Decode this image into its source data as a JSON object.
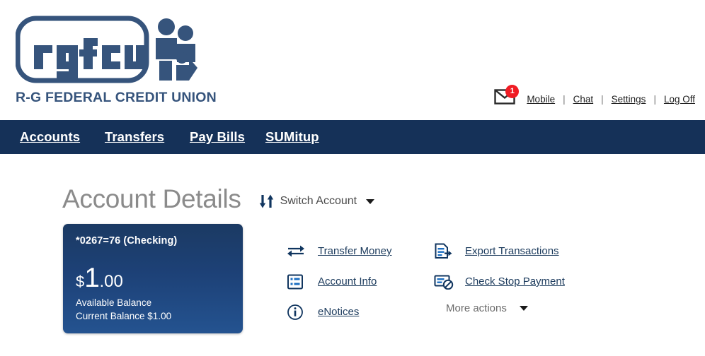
{
  "brand": {
    "logo_text": "rgfcu",
    "tagline": "R-G FEDERAL CREDIT UNION",
    "primary_color": "#153158",
    "logo_color": "#36547c",
    "badge_color": "#f01c24",
    "card_gradient_from": "#1b3a63",
    "card_gradient_to": "#245390"
  },
  "utility_nav": {
    "mail_icon": "envelope-icon",
    "message_count": "1",
    "separator": "|",
    "links": [
      {
        "label": "Mobile"
      },
      {
        "label": "Chat"
      },
      {
        "label": "Settings"
      },
      {
        "label": "Log Off"
      }
    ]
  },
  "main_nav": {
    "items": [
      {
        "label": "Accounts"
      },
      {
        "label": "Transfers"
      },
      {
        "label": "Pay Bills"
      },
      {
        "label": "SUMitup"
      }
    ]
  },
  "page": {
    "title": "Account Details",
    "switch_account": {
      "icon": "switch-arrows-icon",
      "label": "Switch Account",
      "caret": "chevron-down-icon"
    }
  },
  "account_card": {
    "account_name": "*0267=76 (Checking)",
    "currency_symbol": "$",
    "balance_integer": "1",
    "balance_decimal": ".00",
    "available_label": "Available Balance",
    "current_balance_label": "Current Balance $1.00"
  },
  "actions": {
    "column_one": [
      {
        "label": "Transfer Money",
        "icon": "transfer-arrows-icon"
      },
      {
        "label": "Account Info",
        "icon": "list-info-icon"
      },
      {
        "label": "eNotices",
        "icon": "info-circle-icon"
      }
    ],
    "column_two": [
      {
        "label": "Export Transactions",
        "icon": "document-export-icon"
      },
      {
        "label": "Check Stop Payment",
        "icon": "check-block-icon"
      }
    ],
    "more": {
      "label": "More actions",
      "caret": "chevron-down-icon"
    }
  }
}
